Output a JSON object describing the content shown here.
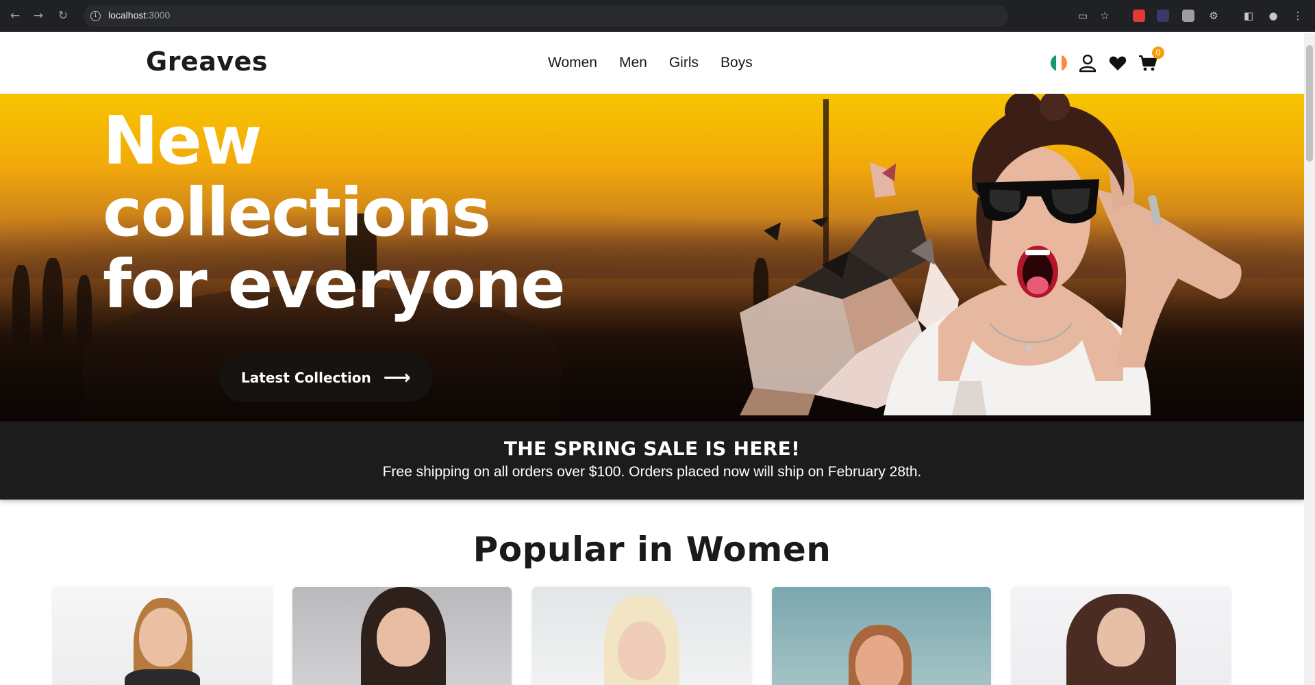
{
  "browser": {
    "url_host": "localhost",
    "url_port": ":3000"
  },
  "site": {
    "logo": "Greaves",
    "nav": [
      "Women",
      "Men",
      "Girls",
      "Boys"
    ],
    "cart_count": "0"
  },
  "hero": {
    "title_line1": "New",
    "title_line2": "collections",
    "title_line3": "for everyone",
    "button_label": "Latest Collection"
  },
  "sale": {
    "headline": "THE SPRING SALE IS HERE!",
    "subtext": "Free shipping on all orders over $100. Orders placed now will ship on February 28th."
  },
  "popular": {
    "title": "Popular in Women"
  },
  "colors": {
    "accent_badge": "#f59e0b",
    "banner_bg": "#1c1c1c",
    "hero_button_bg": "#161310"
  }
}
